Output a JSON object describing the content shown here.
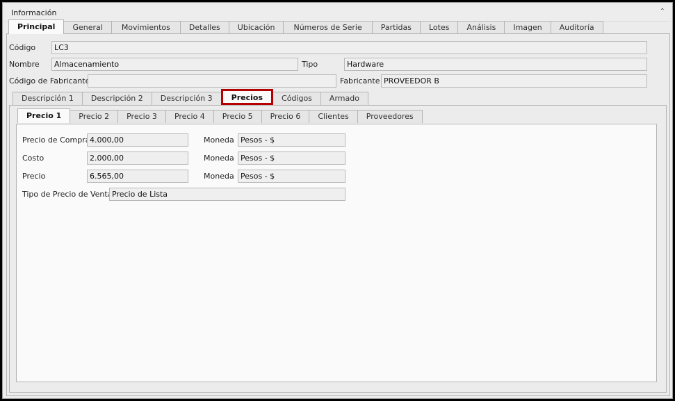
{
  "group": {
    "title": "Información",
    "collapse_icon": "chevron-up-icon"
  },
  "main_tabs": [
    "Principal",
    "General",
    "Movimientos",
    "Detalles",
    "Ubicación",
    "Números de Serie",
    "Partidas",
    "Lotes",
    "Análisis",
    "Imagen",
    "Auditoría"
  ],
  "header_fields": {
    "codigo": {
      "label": "Código",
      "value": "LC3"
    },
    "nombre": {
      "label": "Nombre",
      "value": "Almacenamiento"
    },
    "tipo": {
      "label": "Tipo",
      "value": "Hardware"
    },
    "codigo_fabricante": {
      "label": "Código de Fabricante",
      "value": ""
    },
    "fabricante": {
      "label": "Fabricante",
      "value": "PROVEEDOR B"
    }
  },
  "sub_tabs": [
    "Descripción 1",
    "Descripción 2",
    "Descripción 3",
    "Precios",
    "Códigos",
    "Armado"
  ],
  "price_tabs": [
    "Precio 1",
    "Precio 2",
    "Precio 3",
    "Precio 4",
    "Precio 5",
    "Precio 6",
    "Clientes",
    "Proveedores"
  ],
  "price_form": {
    "precio_compra": {
      "label": "Precio de Compra",
      "value": "4.000,00"
    },
    "costo": {
      "label": "Costo",
      "value": "2.000,00"
    },
    "precio": {
      "label": "Precio",
      "value": "6.565,00"
    },
    "moneda_label": "Moneda",
    "moneda_compra": "Pesos - $",
    "moneda_costo": "Pesos - $",
    "moneda_precio": "Pesos - $",
    "tipo_precio": {
      "label": "Tipo de Precio de Venta",
      "value": "Precio de Lista"
    }
  }
}
